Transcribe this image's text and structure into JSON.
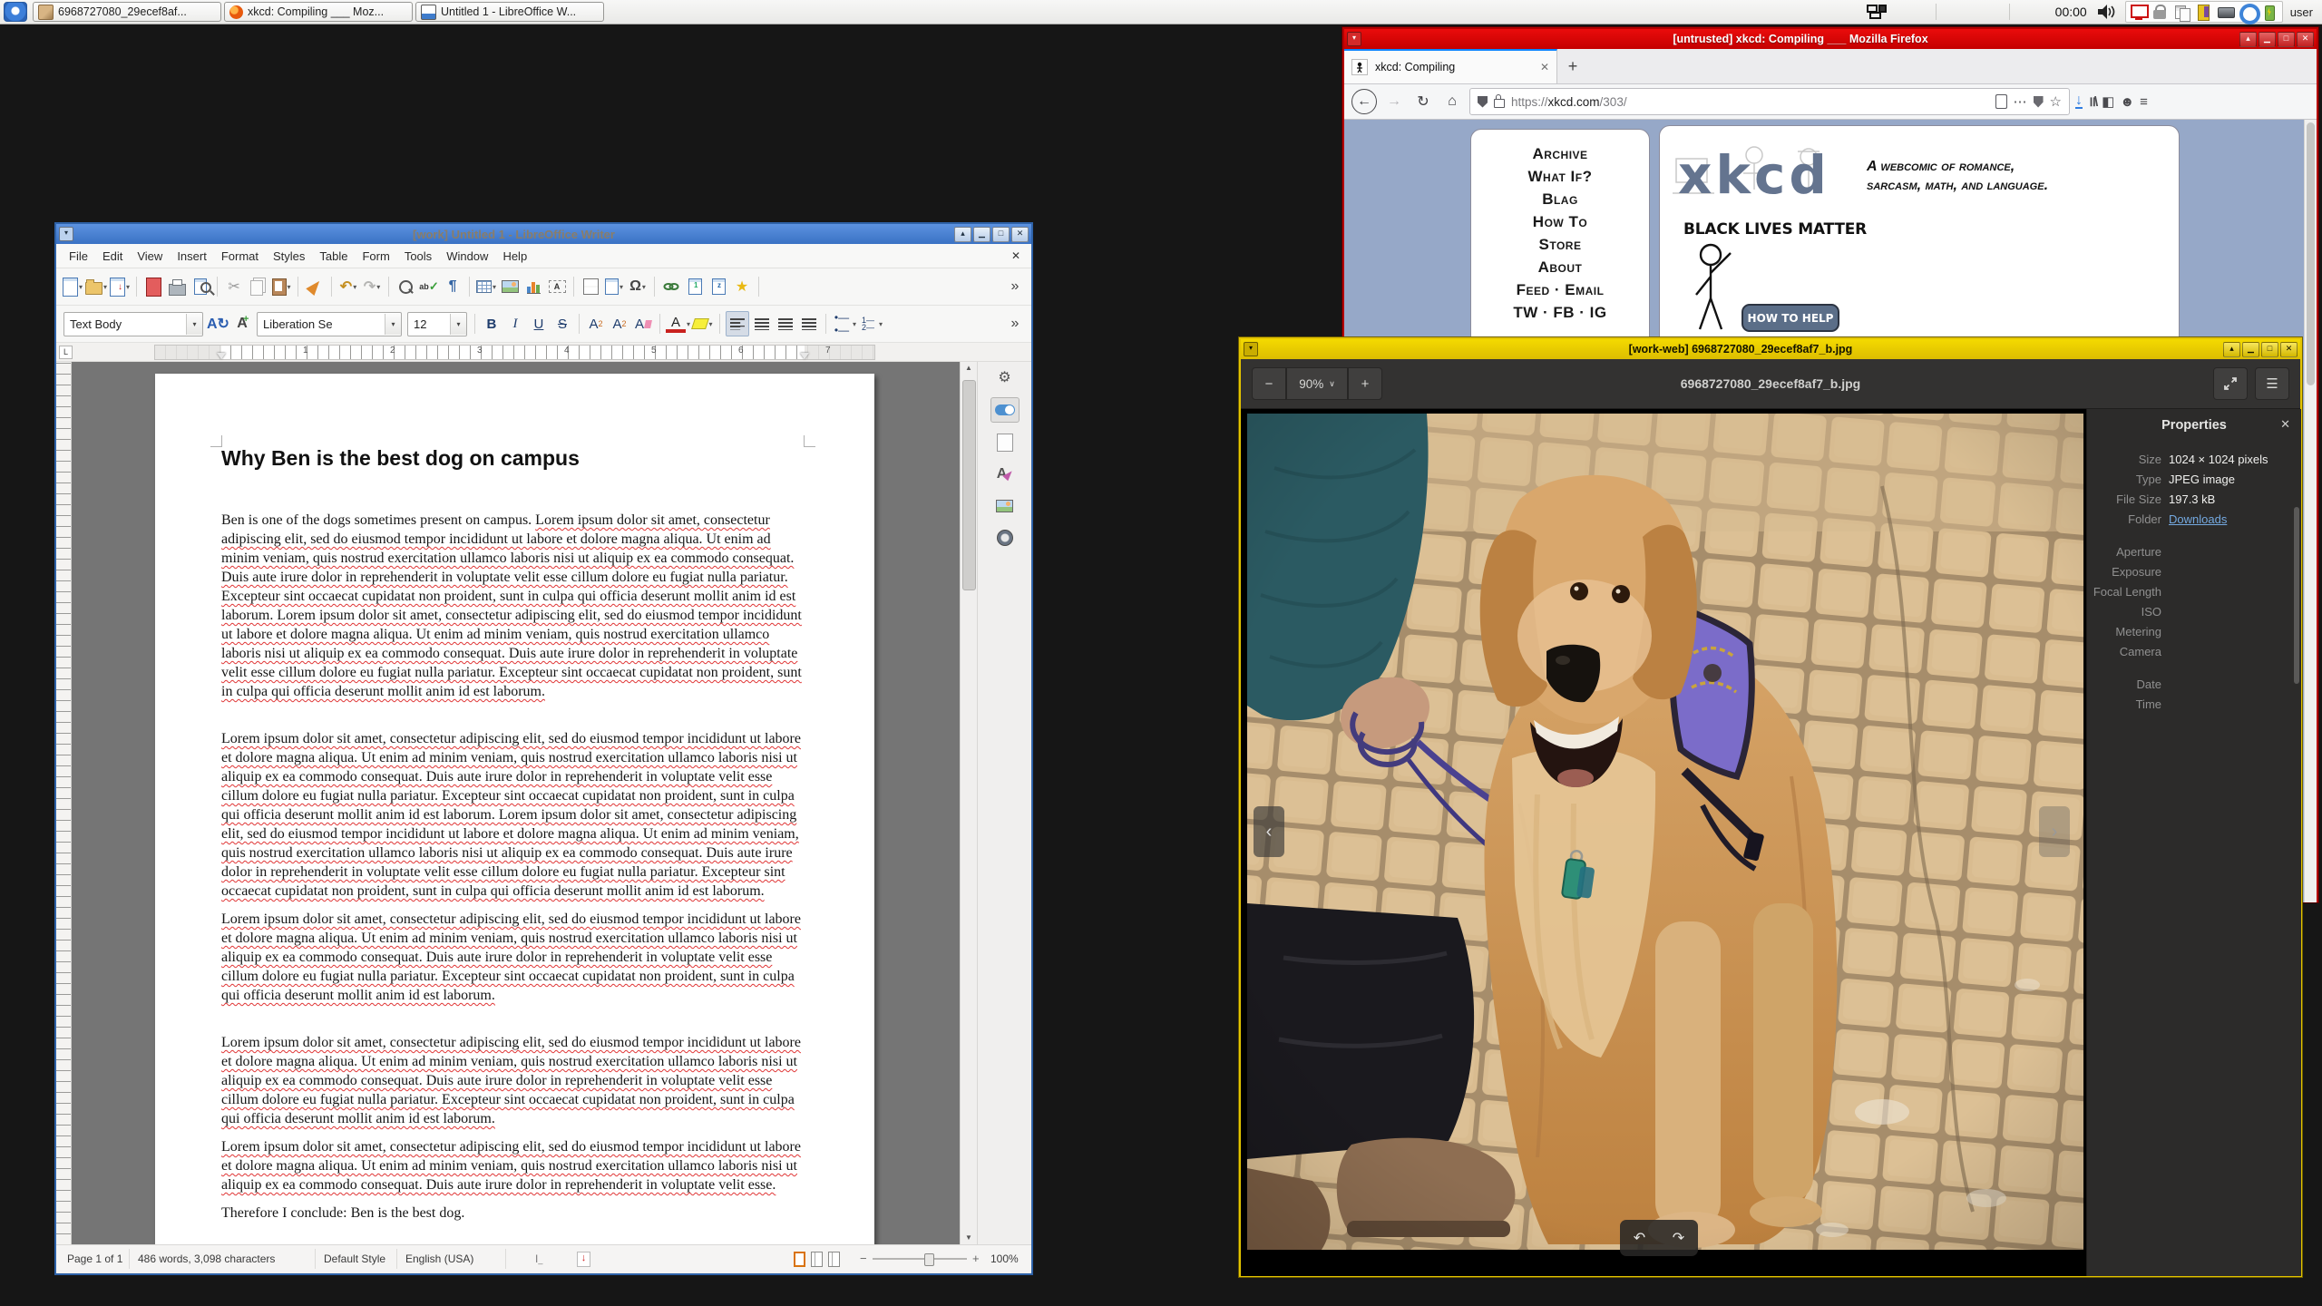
{
  "colors": {
    "qubes_red": "#c40000",
    "qubes_blue": "#3a72c4",
    "qubes_yellow": "#e3c400",
    "xkcd_bg": "#96a8c8",
    "firefox_accent": "#0a84ff"
  },
  "taskbar": {
    "clock": "00:00",
    "user": "user",
    "tasks": [
      {
        "label": "6968727080_29ecef8af..."
      },
      {
        "label": "xkcd: Compiling ___ Moz..."
      },
      {
        "label": "Untitled 1 - LibreOffice W..."
      }
    ]
  },
  "firefox": {
    "title": "[untrusted] xkcd: Compiling ___ Mozilla Firefox",
    "tab": "xkcd: Compiling",
    "newtab": "+",
    "url": {
      "scheme": "https://",
      "host": "xkcd.com",
      "path": "/303/"
    },
    "xkcd": {
      "nav": [
        "Archive",
        "What If?",
        "Blag",
        "How To",
        "Store",
        "About",
        "Feed · Email",
        "TW · FB · IG"
      ],
      "logo": "xkcd",
      "tagline1": "A webcomic of romance,",
      "tagline2": "sarcasm, math, and language.",
      "blm": "BLACK LIVES MATTER",
      "help": "HOW TO HELP"
    }
  },
  "writer": {
    "title": "[work] Untitled 1 - LibreOffice Writer",
    "menus": [
      "File",
      "Edit",
      "View",
      "Insert",
      "Format",
      "Styles",
      "Table",
      "Form",
      "Tools",
      "Window",
      "Help"
    ],
    "close_doc": "✕",
    "style_combo": "Text Body",
    "font_combo": "Liberation Se",
    "size_combo": "12",
    "ruler": [
      "1",
      "2",
      "3",
      "4",
      "5",
      "6",
      "7"
    ],
    "doc": {
      "heading": "Why Ben is the best dog on campus",
      "p1_intro": "Ben is one of the dogs sometimes present on campus. ",
      "p1_lorem": "Lorem ipsum dolor sit amet, consectetur adipiscing elit, sed do eiusmod tempor incididunt ut labore et dolore magna aliqua. Ut enim ad minim veniam, quis nostrud exercitation ullamco laboris nisi ut aliquip ex ea commodo consequat. Duis aute irure dolor in reprehenderit in voluptate velit esse cillum dolore eu fugiat nulla pariatur. Excepteur sint occaecat cupidatat non proident, sunt in culpa qui officia deserunt mollit anim id est laborum. Lorem ipsum dolor sit amet, consectetur adipiscing elit, sed do eiusmod tempor incididunt ut labore et dolore magna aliqua. Ut enim ad minim veniam, quis nostrud exercitation ullamco laboris nisi ut aliquip ex ea commodo consequat. Duis aute irure dolor in reprehenderit in voluptate velit esse cillum dolore eu fugiat nulla pariatur. Excepteur sint occaecat cupidatat non proident, sunt in culpa qui officia deserunt mollit anim id est laborum.",
      "p2": "Lorem ipsum dolor sit amet, consectetur adipiscing elit, sed do eiusmod tempor incididunt ut labore et dolore magna aliqua. Ut enim ad minim veniam, quis nostrud exercitation ullamco laboris nisi ut aliquip ex ea commodo consequat. Duis aute irure dolor in reprehenderit in voluptate velit esse cillum dolore eu fugiat nulla pariatur. Excepteur sint occaecat cupidatat non proident, sunt in culpa qui officia deserunt mollit anim id est laborum. Lorem ipsum dolor sit amet, consectetur adipiscing elit, sed do eiusmod tempor incididunt ut labore et dolore magna aliqua. Ut enim ad minim veniam, quis nostrud exercitation ullamco laboris nisi ut aliquip ex ea commodo consequat. Duis aute irure dolor in reprehenderit in voluptate velit esse cillum dolore eu fugiat nulla pariatur. Excepteur sint occaecat cupidatat non proident, sunt in culpa qui officia deserunt mollit anim id est laborum.",
      "p3": "Lorem ipsum dolor sit amet, consectetur adipiscing elit, sed do eiusmod tempor incididunt ut labore et dolore magna aliqua. Ut enim ad minim veniam, quis nostrud exercitation ullamco laboris nisi ut aliquip ex ea commodo consequat. Duis aute irure dolor in reprehenderit in voluptate velit esse cillum dolore eu fugiat nulla pariatur. Excepteur sint occaecat cupidatat non proident, sunt in culpa qui officia deserunt mollit anim id est laborum.",
      "p4": "Lorem ipsum dolor sit amet, consectetur adipiscing elit, sed do eiusmod tempor incididunt ut labore et dolore magna aliqua. Ut enim ad minim veniam, quis nostrud exercitation ullamco laboris nisi ut aliquip ex ea commodo consequat. Duis aute irure dolor in reprehenderit in voluptate velit esse cillum dolore eu fugiat nulla pariatur. Excepteur sint occaecat cupidatat non proident, sunt in culpa qui officia deserunt mollit anim id est laborum.",
      "p5": "Lorem ipsum dolor sit amet, consectetur adipiscing elit, sed do eiusmod tempor incididunt ut labore et dolore magna aliqua. Ut enim ad minim veniam, quis nostrud exercitation ullamco laboris nisi ut aliquip ex ea commodo consequat. Duis aute irure dolor in reprehenderit in voluptate velit esse.",
      "conclusion": "Therefore I conclude: Ben is the best dog."
    },
    "status": {
      "page": "Page 1 of 1",
      "count": "486 words, 3,098 characters",
      "parastyle": "Default Style",
      "lang": "English (USA)",
      "zoom": "100%"
    }
  },
  "viewer": {
    "title": "[work-web] 6968727080_29ecef8af7_b.jpg",
    "zoom": "90%",
    "filename": "6968727080_29ecef8af7_b.jpg",
    "props": {
      "title": "Properties",
      "size_label": "Size",
      "size": "1024 × 1024 pixels",
      "type_label": "Type",
      "type": "JPEG image",
      "filesize_label": "File Size",
      "filesize": "197.3 kB",
      "folder_label": "Folder",
      "folder": "Downloads",
      "exif_labels": [
        "Aperture",
        "Exposure",
        "Focal Length",
        "ISO",
        "Metering",
        "Camera"
      ],
      "dt_labels": [
        "Date",
        "Time"
      ]
    }
  }
}
